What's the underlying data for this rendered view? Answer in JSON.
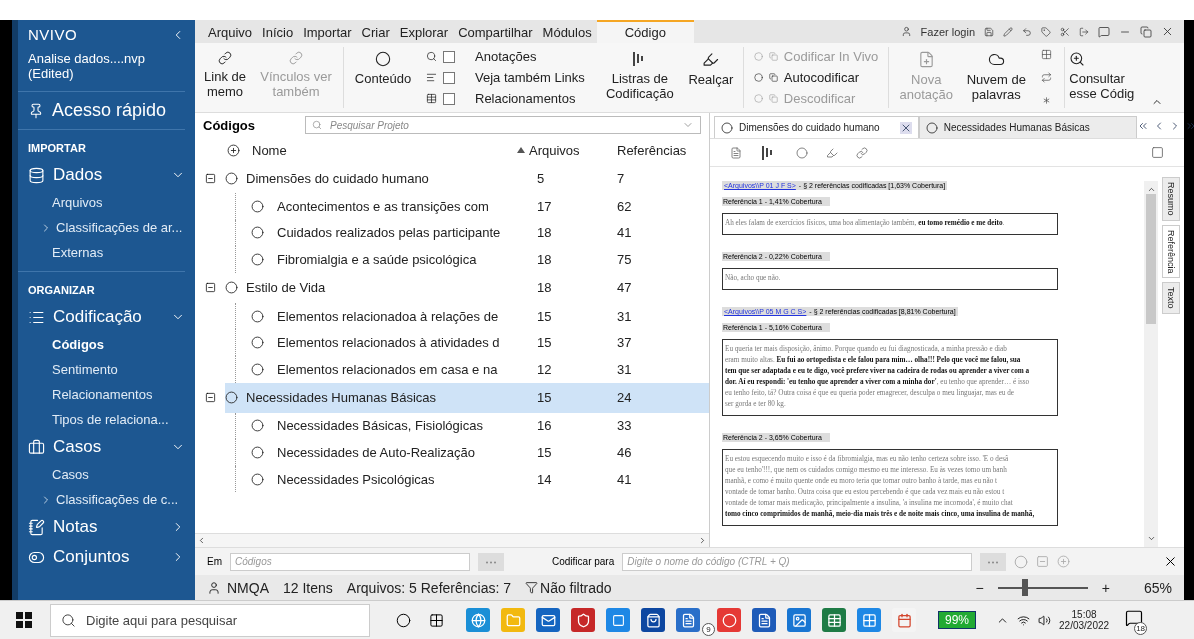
{
  "sidebar": {
    "logo": "NVIVO",
    "project": "Analise dados....nvp",
    "project_state": "(Edited)",
    "quick_access": "Acesso rápido",
    "sections": [
      {
        "heading": "IMPORTAR",
        "groups": [
          {
            "label": "Dados",
            "kind": "data",
            "expanded": true,
            "items": [
              {
                "label": "Arquivos",
                "selected": false,
                "expandable": false
              },
              {
                "label": "Classificações de ar...",
                "selected": false,
                "expandable": true
              },
              {
                "label": "Externas",
                "selected": false,
                "expandable": false
              }
            ]
          }
        ]
      },
      {
        "heading": "ORGANIZAR",
        "groups": [
          {
            "label": "Codificação",
            "kind": "coding",
            "expanded": true,
            "items": [
              {
                "label": "Códigos",
                "selected": true,
                "expandable": false
              },
              {
                "label": "Sentimento",
                "selected": false,
                "expandable": false
              },
              {
                "label": "Relacionamentos",
                "selected": false,
                "expandable": false
              },
              {
                "label": "Tipos de relaciona...",
                "selected": false,
                "expandable": false
              }
            ]
          },
          {
            "label": "Casos",
            "kind": "cases",
            "expanded": true,
            "items": [
              {
                "label": "Casos",
                "selected": false,
                "expandable": false
              },
              {
                "label": "Classificações de c...",
                "selected": false,
                "expandable": true
              }
            ]
          },
          {
            "label": "Notas",
            "kind": "notes",
            "expanded": false
          },
          {
            "label": "Conjuntos",
            "kind": "sets",
            "expanded": false
          }
        ]
      }
    ]
  },
  "menu": {
    "tabs": [
      {
        "label": "Arquivo",
        "selected": false
      },
      {
        "label": "Início",
        "selected": false
      },
      {
        "label": "Importar",
        "selected": false
      },
      {
        "label": "Criar",
        "selected": false
      },
      {
        "label": "Explorar",
        "selected": false
      },
      {
        "label": "Compartilhar",
        "selected": false
      },
      {
        "label": "Módulos",
        "selected": false
      },
      {
        "label": "Código",
        "selected": true
      }
    ],
    "login": "Fazer login"
  },
  "ribbon": {
    "links": [
      {
        "label": "Link de memo",
        "disabled": false
      },
      {
        "label": "Vínculos ver também",
        "disabled": true
      }
    ],
    "content": {
      "label": "Conteúdo",
      "disabled": false
    },
    "checks": [
      {
        "label": "Anotações",
        "checked": false,
        "kind": "search"
      },
      {
        "label": "Veja também Links",
        "checked": false,
        "kind": "lines"
      },
      {
        "label": "Relacionamentos",
        "checked": false,
        "kind": "table"
      }
    ],
    "view": [
      {
        "label": "Listras de Codificação",
        "kind": "stripes",
        "disabled": false
      },
      {
        "label": "Realçar",
        "kind": "marker",
        "disabled": false
      }
    ],
    "code_actions": [
      {
        "label": "Codificar In Vivo",
        "disabled": true
      },
      {
        "label": "Autocodificar",
        "disabled": false
      },
      {
        "label": "Descodificar",
        "disabled": true
      }
    ],
    "tools": [
      {
        "label": "Nova anotação",
        "kind": "note",
        "disabled": true
      },
      {
        "label": "Nuvem de palavras",
        "kind": "cloud",
        "disabled": false
      }
    ],
    "query": {
      "label": "Consultar esse Códig",
      "disabled": false
    }
  },
  "codes": {
    "title": "Códigos",
    "search_placeholder": "Pesquisar Projeto",
    "columns": [
      "Nome",
      "Arquivos",
      "Referências"
    ],
    "rows": [
      {
        "name": "Dimensões do cuidado humano",
        "files": "5",
        "refs": "7",
        "selected": false,
        "expanded": true,
        "children": [
          {
            "name": "Acontecimentos e as transições com",
            "files": "17",
            "refs": "62",
            "selected": false
          },
          {
            "name": "Cuidados realizados pelas participante",
            "files": "18",
            "refs": "41",
            "selected": false
          },
          {
            "name": "Fibromialgia e a saúde psicológica",
            "files": "18",
            "refs": "75",
            "selected": false
          }
        ]
      },
      {
        "name": "Estilo de Vida",
        "files": "18",
        "refs": "47",
        "selected": false,
        "expanded": true,
        "children": [
          {
            "name": "Elementos relacionadoa à relações de",
            "files": "15",
            "refs": "31",
            "selected": false
          },
          {
            "name": "Elementos relacionados à atividades d",
            "files": "15",
            "refs": "37",
            "selected": false
          },
          {
            "name": "Elementos relacionados em casa e na",
            "files": "12",
            "refs": "31",
            "selected": false
          }
        ]
      },
      {
        "name": "Necessidades Humanas Básicas",
        "files": "15",
        "refs": "24",
        "selected": true,
        "expanded": true,
        "children": [
          {
            "name": "Necessidades Básicas, Fisiológicas",
            "files": "16",
            "refs": "33",
            "selected": false
          },
          {
            "name": "Necessidades de Auto-Realização",
            "files": "15",
            "refs": "46",
            "selected": false
          },
          {
            "name": "Necessidades Psicológicas",
            "files": "14",
            "refs": "41",
            "selected": false
          }
        ]
      }
    ]
  },
  "detail": {
    "tabs": [
      {
        "label": "Dimensões do cuidado humano",
        "selected": true
      },
      {
        "label": "Necessidades Humanas Básicas",
        "selected": false
      }
    ],
    "side_tabs": [
      {
        "label": "Resumo",
        "selected": false
      },
      {
        "label": "Referência",
        "selected": true
      },
      {
        "label": "Texto",
        "selected": false
      }
    ],
    "sources": [
      {
        "link": "<Arquivos\\\\P 01 J F S>",
        "summary": "- § 2 referências codificadas  [1,63% Cobertura]",
        "references": [
          {
            "title": "Referência 1 - 1,41% Cobertura",
            "lines": [
              "Ah eles falam de exercícios físicos, uma boa alimentação também, **eu tomo remédio e me deito**."
            ]
          },
          {
            "title": "Referência 2 - 0,22% Cobertura",
            "lines": [
              "Não, acho que não."
            ]
          }
        ]
      },
      {
        "link": "<Arquivos\\\\P 05 M G C S>",
        "summary": "- § 2 referências codificadas  [8,81% Cobertura]",
        "references": [
          {
            "title": "Referência 1 - 5,16% Cobertura",
            "lines": [
              "Eu queria ter mais disposição, ânimo. Porque quando eu fui diagnosticada, a minha pressão e diab",
              "eram muito altas. **Eu fui ao ortopedista e ele falou para mim… olha!!! Pelo que você me falou, sua**",
              "**tem que ser adaptada e eu te digo, você prefere viver na cadeira de rodas ou aprender a viver com a**",
              "**dor. Aí eu respondi: 'eu tenho que aprender a viver com a minha dor'**, eu tenho que aprender… é isso",
              "eu tenho feito, tá? Outra coisa é que eu queria poder emagrecer, desculpa o meu linguajar, mas eu de",
              "ser gorda e ter 80 kg."
            ]
          },
          {
            "title": "Referência 2 - 3,65% Cobertura",
            "lines": [
              "Eu estou esquecendo muito e isso é da fibromialgia, mas eu não tenho certeza sobre isso. 'E o desâ",
              "que eu tenho'!!!, que nem os cuidados comigo mesmo eu me interesso. Eu às vezes tomo um banh",
              "manhã, e como é muito quente onde eu moro teria que tomar outro banho à tarde, mas eu não t",
              "vontade de tomar banho. Outra coisa que eu estou percebendo é que cada vez mais eu não estou t",
              "vontade de tomar mais medicação, principalmente a insulina, 'a insulina me incomoda', é muito chat",
              "**tomo cinco comprimidos de manhã, meio-dia mais três e de noite mais cinco, uma insulina de manhã,**"
            ]
          }
        ]
      }
    ]
  },
  "code_bar": {
    "in_label": "Em",
    "in_placeholder": "Códigos",
    "code_label": "Codificar para",
    "code_placeholder": "Digite o nome do código (CTRL + Q)"
  },
  "status_bar": {
    "user": "NMQA",
    "items": "12 Itens",
    "summary": "Arquivos: 5 Referências: 7",
    "filter": "Não filtrado",
    "zoom_minus": "−",
    "zoom_plus": "+",
    "zoom_level": {
      "level": 0.3
    },
    "zoom_percent": "65%"
  },
  "taskbar": {
    "search_placeholder": "Digite aqui para pesquisar",
    "badge": "9",
    "battery": "99%",
    "time": "15:08",
    "date": "22/03/2022",
    "notifications": "18"
  }
}
